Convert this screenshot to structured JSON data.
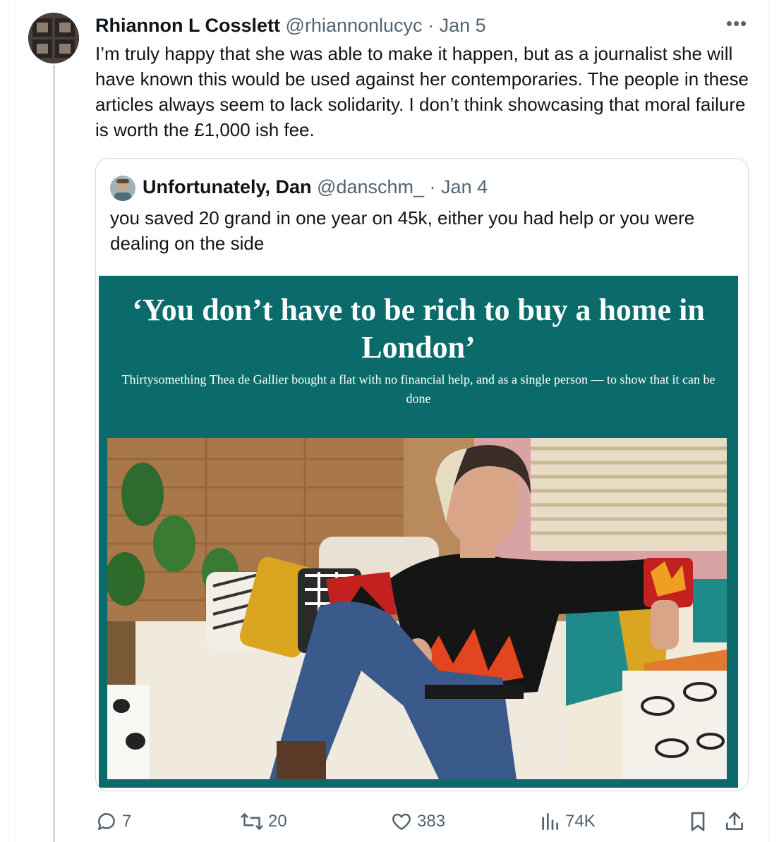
{
  "tweet": {
    "author_name": "Rhiannon L Cosslett",
    "author_handle": "@rhiannonlucyc",
    "separator": "·",
    "date": "Jan 5",
    "more_label": "•••",
    "text": "I’m truly happy that she was able to make it happen, but as a journalist she will have known this would be used against her contemporaries. The people in these articles always seem to lack solidarity. I don’t think showcasing that moral failure is worth  the £1,000 ish fee.",
    "avatar_icon": "author-avatar"
  },
  "quote": {
    "author_name": "Unfortunately, Dan",
    "author_handle": "@danschm_",
    "separator": "·",
    "date": "Jan 4",
    "text": "you saved 20 grand in one year on 45k, either you had help or you were dealing on the side",
    "article": {
      "headline": "‘You don’t have to be rich to buy a home in London’",
      "subheadline": "Thirtysomething Thea de Gallier bought a flat with no financial help, and as a single person — to show that it can be done",
      "background_color": "#0b6b6b"
    }
  },
  "actions": {
    "reply_count": "7",
    "retweet_count": "20",
    "like_count": "383",
    "views_count": "74K",
    "icons": [
      "reply-icon",
      "retweet-icon",
      "like-icon",
      "views-icon",
      "bookmark-icon",
      "share-icon"
    ]
  },
  "colors": {
    "text": "#0f1419",
    "secondary": "#536471",
    "border": "#cfd9de",
    "article_teal": "#0b6b6b"
  }
}
